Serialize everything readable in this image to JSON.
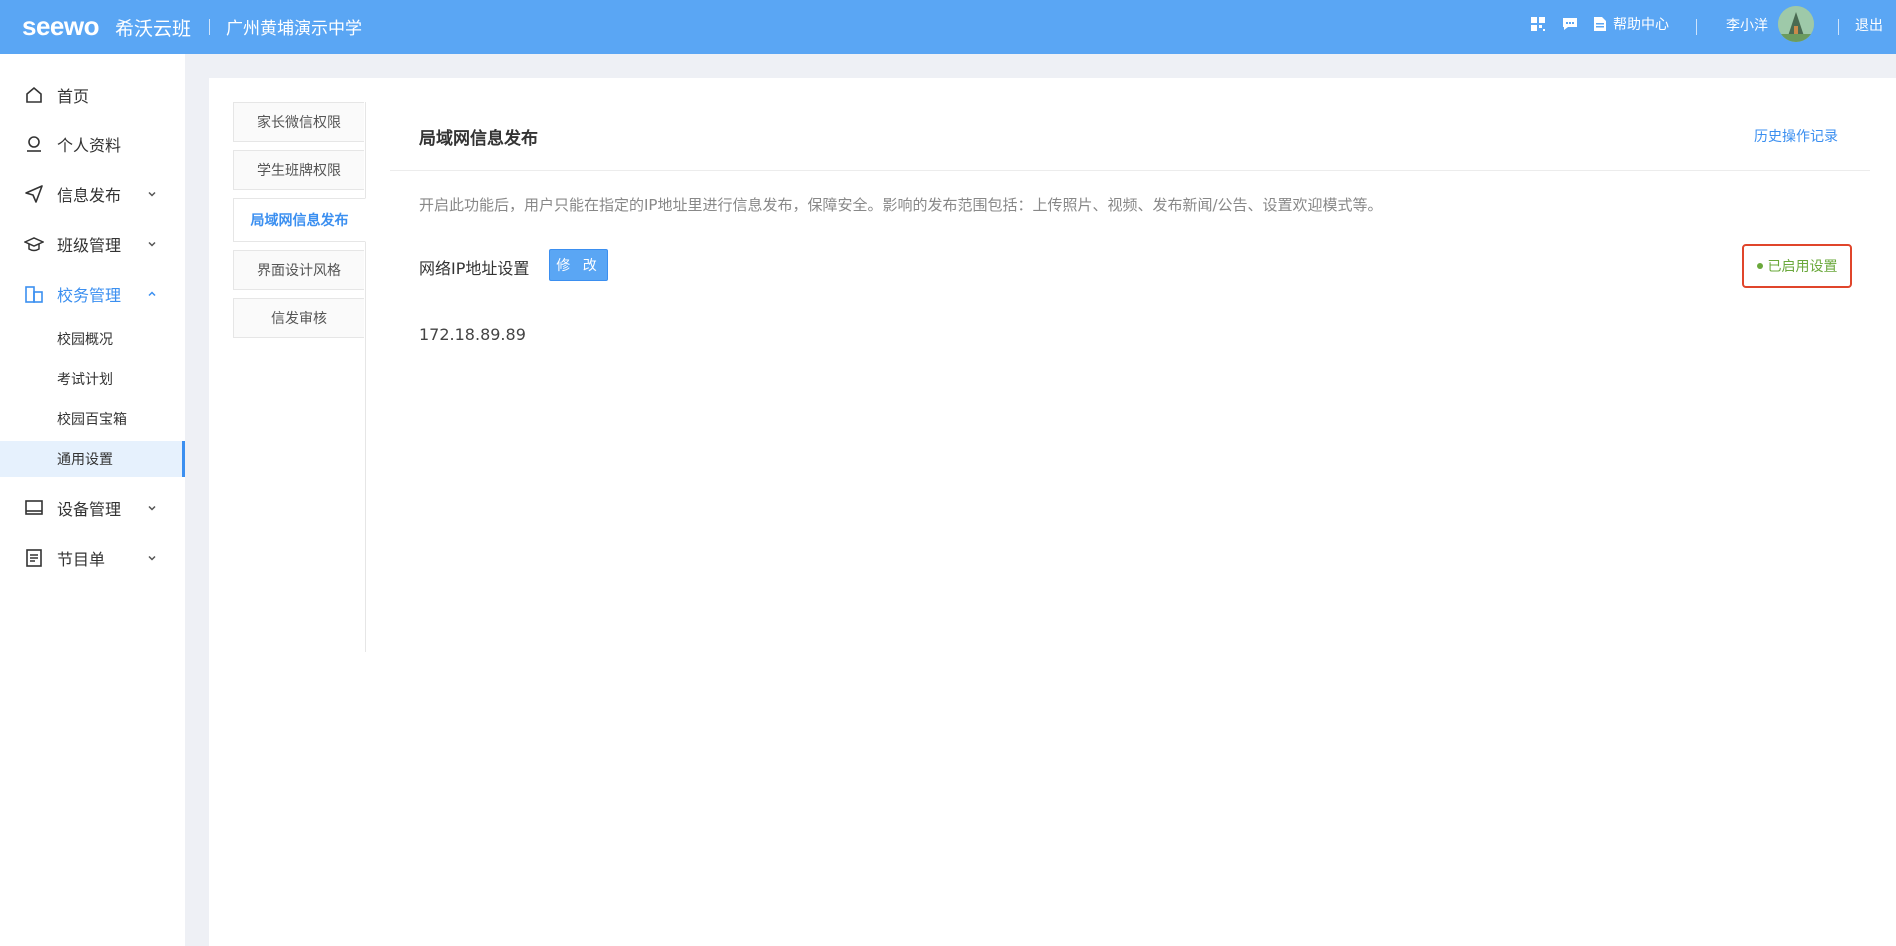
{
  "header": {
    "logo": "seewo",
    "app_name": "希沃云班",
    "school": "广州黄埔演示中学",
    "help": "帮助中心",
    "user": "李小洋",
    "logout": "退出"
  },
  "sidebar": {
    "items": [
      {
        "label": "首页",
        "icon": "home-icon"
      },
      {
        "label": "个人资料",
        "icon": "user-icon"
      },
      {
        "label": "信息发布",
        "icon": "send-icon"
      },
      {
        "label": "班级管理",
        "icon": "graduation-cap-icon"
      },
      {
        "label": "校务管理",
        "icon": "school-affairs-icon"
      },
      {
        "label": "设备管理",
        "icon": "monitor-icon"
      },
      {
        "label": "节目单",
        "icon": "program-list-icon"
      }
    ],
    "sub_items": [
      "校园概况",
      "考试计划",
      "校园百宝箱",
      "通用设置"
    ]
  },
  "tabs": [
    "家长微信权限",
    "学生班牌权限",
    "局域网信息发布",
    "界面设计风格",
    "信发审核"
  ],
  "content": {
    "title": "局域网信息发布",
    "history_link": "历史操作记录",
    "description": "开启此功能后，用户只能在指定的IP地址里进行信息发布，保障安全。影响的发布范围包括：上传照片、视频、发布新闻/公告、设置欢迎模式等。",
    "ip_label": "网络IP地址设置",
    "edit_button": "修 改",
    "status": "已启用设置",
    "ip_value": "172.18.89.89"
  },
  "colors": {
    "header_bg": "#5aa6f4",
    "accent": "#3b8ff0",
    "status_green": "#6aa83b",
    "highlight_red": "#e0452b"
  }
}
